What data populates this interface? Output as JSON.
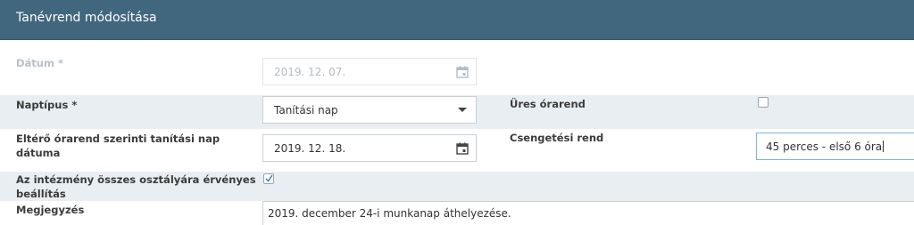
{
  "header": {
    "title": "Tanévrend módosítása"
  },
  "datum": {
    "label": "Dátum *",
    "value": "2019. 12. 07."
  },
  "naptipus": {
    "label": "Naptípus *",
    "value": "Tanítási nap"
  },
  "ures_orarend": {
    "label": "Üres órarend",
    "checked": false
  },
  "elteo_datum": {
    "label_line1": "Eltérő órarend szerinti tanítási nap",
    "label_line2": "dátuma",
    "value": "2019. 12. 18."
  },
  "csengetesi_rend": {
    "label": "Csengetési rend",
    "value": "45 perces - első 6 óra"
  },
  "osszes_osztaly": {
    "label_line1": "Az intézmény összes osztályára érvényes",
    "label_line2": "beállítás",
    "checked": true
  },
  "megjegyzes": {
    "label": "Megjegyzés",
    "value": "2019. december 24-i munkanap áthelyezése."
  },
  "colors": {
    "header_bg": "#41677f",
    "stripe_bg": "#e9eef2",
    "focus_border": "#7fb3d5"
  },
  "icons": {
    "calendar": "calendar-icon",
    "dropdown": "caret-down-icon",
    "check": "check-icon"
  }
}
